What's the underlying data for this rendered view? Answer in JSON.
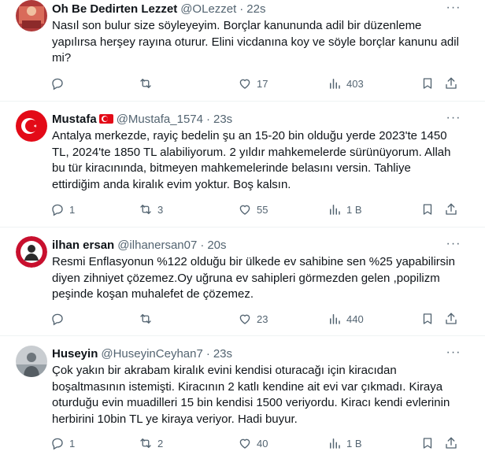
{
  "tweets": [
    {
      "name": "Oh Be Dedirten Lezzet",
      "handle": "@OLezzet",
      "time": "22s",
      "text": "Nasıl son bulur size söyleyeyim. Borçlar kanununda adil bir düzenleme yapılırsa herşey rayına oturur. Elini vicdanına koy ve söyle borçlar kanunu adil mi?",
      "replies": "",
      "retweets": "",
      "likes": "17",
      "views": "403"
    },
    {
      "name": "Mustafa",
      "handle": "@Mustafa_1574",
      "time": "23s",
      "text": "Antalya merkezde, rayiç bedelin şu an 15-20 bin olduğu yerde 2023'te 1450 TL, 2024'te 1850 TL alabiliyorum. 2 yıldır mahkemelerde sürünüyorum. Allah bu tür kiracınında, bitmeyen mahkemelerinde belasını versin. Tahliye ettirdiğim anda kiralık evim yoktur. Boş kalsın.",
      "replies": "1",
      "retweets": "3",
      "likes": "55",
      "views": "1 B"
    },
    {
      "name": "ilhan ersan",
      "handle": "@ilhanersan07",
      "time": "20s",
      "text": "Resmi Enflasyonun %122 olduğu  bir ülkede ev sahibine sen %25 yapabilirsin diyen zihniyet çözemez.Oy uğruna ev sahipleri görmezden gelen ,popilizm peşinde  koşan muhalefet de çözemez.",
      "replies": "",
      "retweets": "",
      "likes": "23",
      "views": "440"
    },
    {
      "name": "Huseyin",
      "handle": "@HuseyinCeyhan7",
      "time": "23s",
      "text": "Çok yakın bir akrabam kiralık evini kendisi oturacağı için kiracıdan boşaltmasının istemişti. Kiracının 2 katlı kendine ait evi var çıkmadı. Kiraya oturduğu evin muadilleri 15 bin kendisi 1500 veriyordu. Kiracı kendi evlerinin herbirini 10bin TL ye kiraya veriyor. Hadi buyur.",
      "replies": "1",
      "retweets": "2",
      "likes": "40",
      "views": "1 B"
    }
  ],
  "more_label": "···",
  "colors": {
    "text": "#0f1419",
    "muted": "#536471",
    "border": "#eff3f4"
  }
}
